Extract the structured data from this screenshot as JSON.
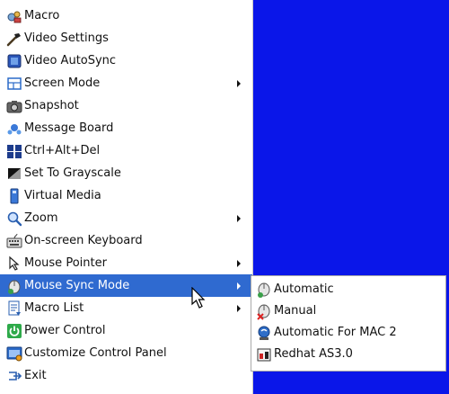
{
  "main_menu": {
    "items": [
      {
        "label": "Macro",
        "icon": "macro-icon",
        "has_submenu": false
      },
      {
        "label": "Video Settings",
        "icon": "video-settings-icon",
        "has_submenu": false
      },
      {
        "label": "Video AutoSync",
        "icon": "video-autosync-icon",
        "has_submenu": false
      },
      {
        "label": "Screen Mode",
        "icon": "screen-mode-icon",
        "has_submenu": true
      },
      {
        "label": "Snapshot",
        "icon": "camera-icon",
        "has_submenu": false
      },
      {
        "label": "Message Board",
        "icon": "message-board-icon",
        "has_submenu": false
      },
      {
        "label": "Ctrl+Alt+Del",
        "icon": "ctrl-alt-del-icon",
        "has_submenu": false
      },
      {
        "label": "Set To Grayscale",
        "icon": "grayscale-icon",
        "has_submenu": false
      },
      {
        "label": "Virtual Media",
        "icon": "virtual-media-icon",
        "has_submenu": false
      },
      {
        "label": "Zoom",
        "icon": "zoom-icon",
        "has_submenu": true
      },
      {
        "label": "On-screen Keyboard",
        "icon": "keyboard-icon",
        "has_submenu": false
      },
      {
        "label": "Mouse Pointer",
        "icon": "mouse-pointer-icon",
        "has_submenu": true
      },
      {
        "label": "Mouse Sync Mode",
        "icon": "mouse-sync-icon",
        "has_submenu": true,
        "highlighted": true
      },
      {
        "label": "Macro List",
        "icon": "macro-list-icon",
        "has_submenu": true
      },
      {
        "label": "Power Control",
        "icon": "power-icon",
        "has_submenu": false
      },
      {
        "label": "Customize Control Panel",
        "icon": "customize-panel-icon",
        "has_submenu": false
      },
      {
        "label": "Exit",
        "icon": "exit-icon",
        "has_submenu": false
      }
    ]
  },
  "submenu": {
    "parent": "Mouse Sync Mode",
    "items": [
      {
        "label": "Automatic",
        "icon": "mouse-automatic-icon"
      },
      {
        "label": "Manual",
        "icon": "mouse-manual-icon"
      },
      {
        "label": "Automatic For MAC 2",
        "icon": "mac-icon"
      },
      {
        "label": "Redhat AS3.0",
        "icon": "redhat-icon"
      }
    ]
  },
  "colors": {
    "highlight": "#2f6ad0",
    "desktop_background": "#0a16e9"
  }
}
